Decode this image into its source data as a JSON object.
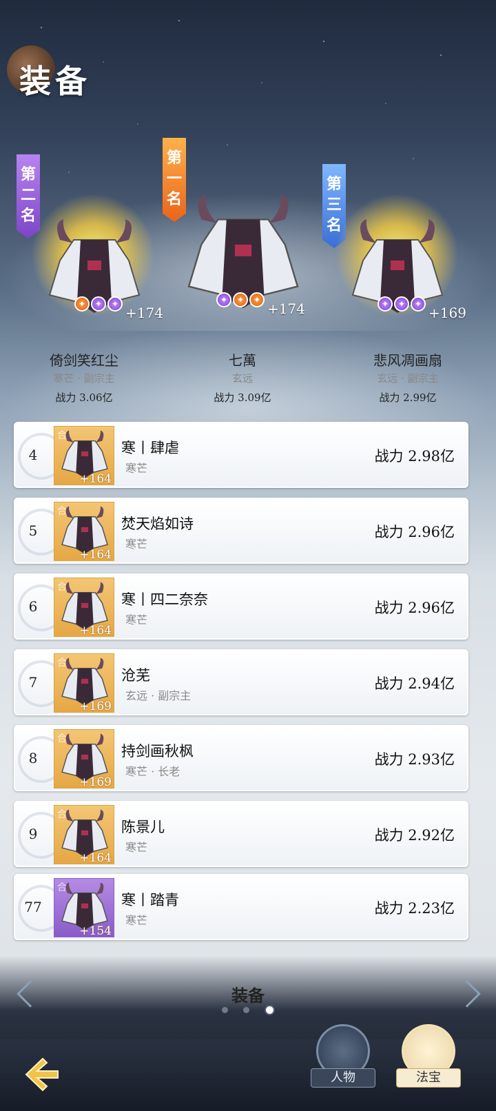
{
  "page": {
    "title": "装备"
  },
  "podium": [
    {
      "rank_label": "第二名",
      "rank_chars": [
        "第",
        "二",
        "名"
      ],
      "name": "倚剑笑红尘",
      "subtitle": "寒芒 · 副宗主",
      "power": "战力 3.06亿",
      "level": "+174",
      "gems": [
        "orange",
        "purple",
        "purple"
      ],
      "banner_color": "#9b64e0"
    },
    {
      "rank_label": "第一名",
      "rank_chars": [
        "第",
        "一",
        "名"
      ],
      "name": "七萬",
      "subtitle": "玄远",
      "power": "战力 3.09亿",
      "level": "+174",
      "gems": [
        "purple",
        "orange",
        "orange"
      ],
      "banner_color": "#f08a2c"
    },
    {
      "rank_label": "第三名",
      "rank_chars": [
        "第",
        "三",
        "名"
      ],
      "name": "悲风凋画扇",
      "subtitle": "玄远 · 副宗主",
      "power": "战力 2.99亿",
      "level": "+169",
      "gems": [
        "purple",
        "purple",
        "purple"
      ],
      "banner_color": "#4f86e6"
    }
  ],
  "ranking": [
    {
      "rank": "4",
      "name": "寒丨肆虐",
      "subtitle": "寒芒",
      "power": "战力 2.98亿",
      "level": "+164",
      "thumb": "gold",
      "mark": "合"
    },
    {
      "rank": "5",
      "name": "焚天焰如诗",
      "subtitle": "寒芒",
      "power": "战力 2.96亿",
      "level": "+164",
      "thumb": "gold",
      "mark": "合"
    },
    {
      "rank": "6",
      "name": "寒丨四二奈奈",
      "subtitle": "寒芒",
      "power": "战力 2.96亿",
      "level": "+164",
      "thumb": "gold",
      "mark": "合"
    },
    {
      "rank": "7",
      "name": "沧芜",
      "subtitle": "玄远 · 副宗主",
      "power": "战力 2.94亿",
      "level": "+169",
      "thumb": "gold",
      "mark": "合"
    },
    {
      "rank": "8",
      "name": "持剑画秋枫",
      "subtitle": "寒芒 · 长老",
      "power": "战力 2.93亿",
      "level": "+169",
      "thumb": "gold",
      "mark": "合"
    },
    {
      "rank": "9",
      "name": "陈景儿",
      "subtitle": "寒芒",
      "power": "战力 2.92亿",
      "level": "+164",
      "thumb": "gold",
      "mark": "合"
    },
    {
      "rank": "77",
      "name": "寒丨踏青",
      "subtitle": "寒芒",
      "power": "战力 2.23亿",
      "level": "+154",
      "thumb": "purple",
      "mark": "合"
    }
  ],
  "pager": {
    "category": "装备",
    "page_count": 3,
    "active_page": 3
  },
  "bottom_nav": {
    "tab_person": "人物",
    "tab_treasure": "法宝",
    "active": "法宝"
  }
}
